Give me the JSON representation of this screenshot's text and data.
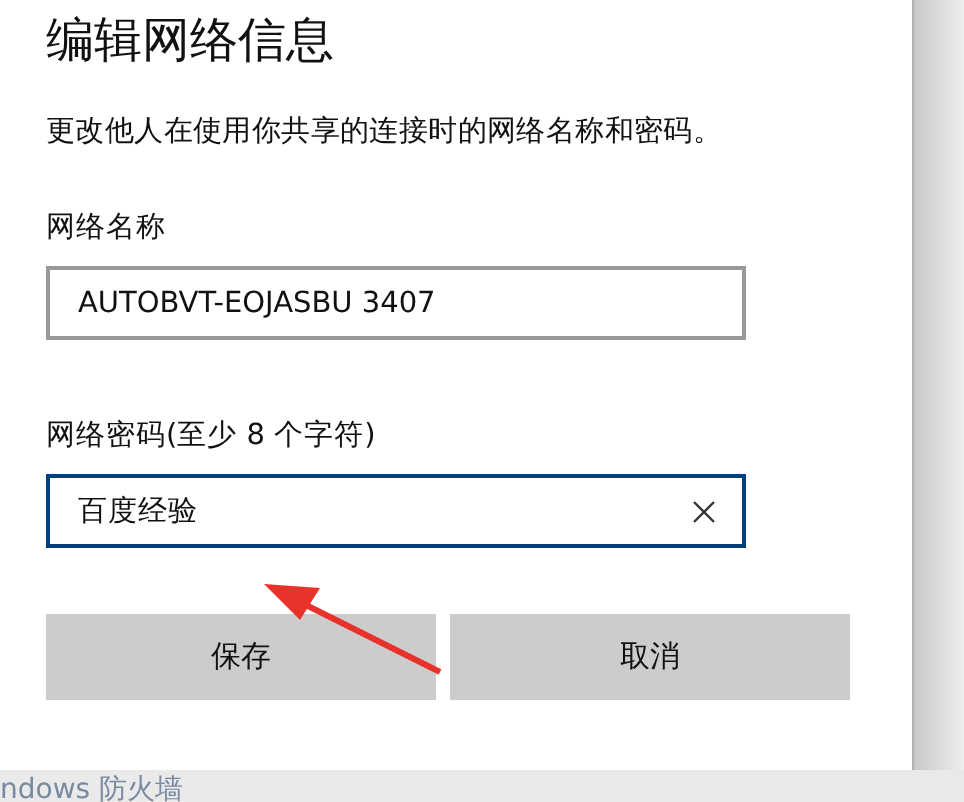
{
  "dialog": {
    "title": "编辑网络信息",
    "description": "更改他人在使用你共享的连接时的网络名称和密码。",
    "fields": [
      {
        "label": "网络名称",
        "value": "AUTOBVT-EOJASBU 3407",
        "focused": false,
        "clear_button": false
      },
      {
        "label": "网络密码(至少 8 个字符)",
        "value": "百度经验",
        "focused": true,
        "clear_button": true
      }
    ],
    "buttons": [
      "保存",
      "取消"
    ]
  },
  "background_text": "ndows 防火墙"
}
